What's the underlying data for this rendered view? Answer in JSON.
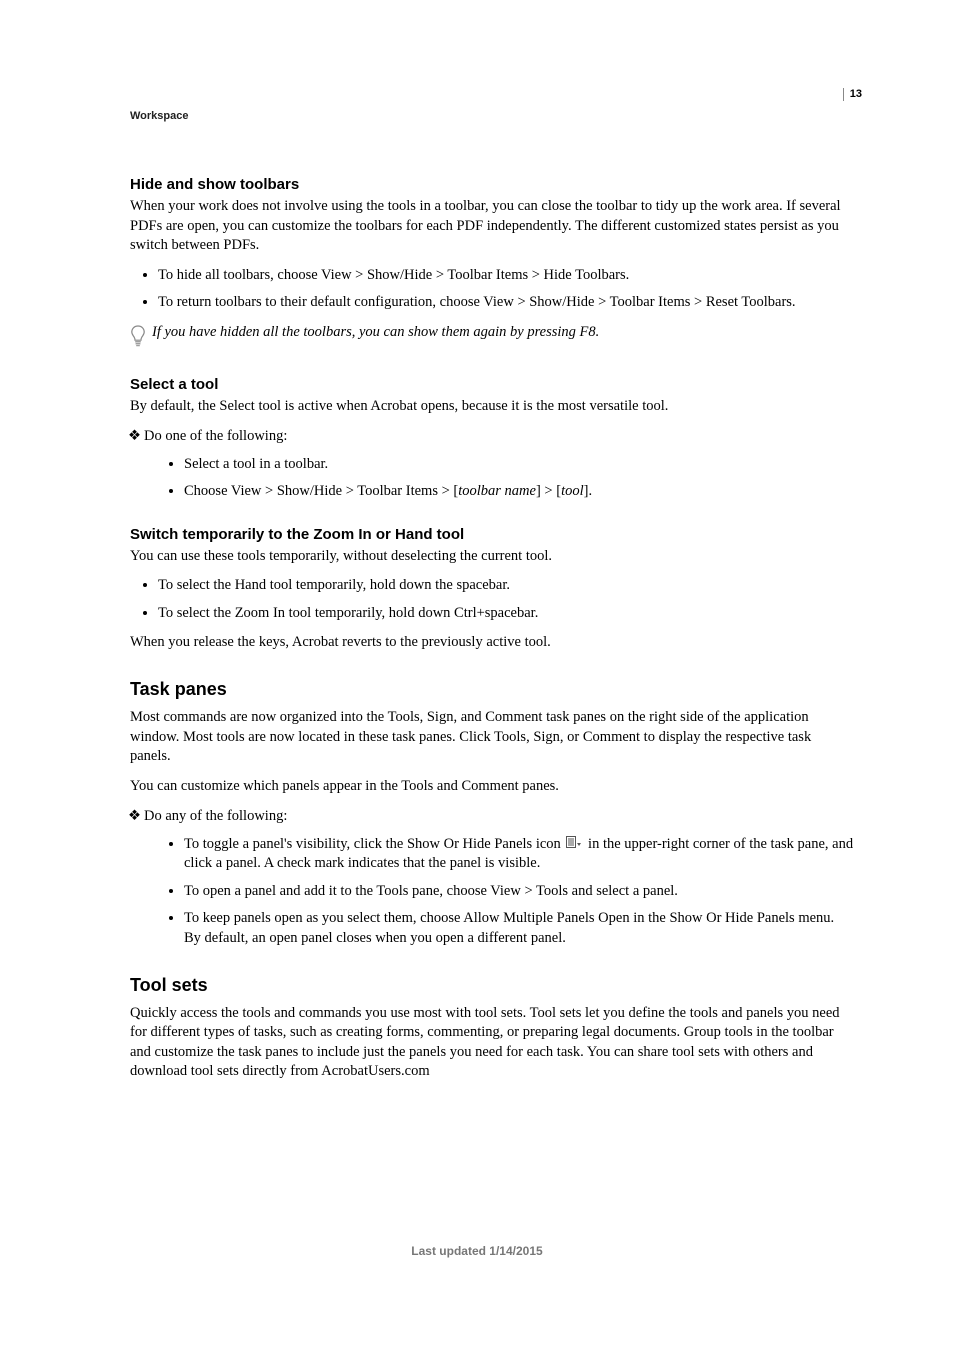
{
  "header": {
    "running_head": "Workspace",
    "page_number": "13"
  },
  "sections": {
    "hide_show": {
      "title": "Hide and show toolbars",
      "p1": "When your work does not involve using the tools in a toolbar, you can close the toolbar to tidy up the work area. If several PDFs are open, you can customize the toolbars for each PDF independently. The different customized states persist as you switch between PDFs.",
      "b1": "To hide all toolbars, choose View > Show/Hide > Toolbar Items > Hide Toolbars.",
      "b2": "To return toolbars to their default configuration, choose View > Show/Hide > Toolbar Items > Reset Toolbars.",
      "tip": "If you have hidden all the toolbars, you can show them again by pressing F8."
    },
    "select_tool": {
      "title": "Select a tool",
      "p1": "By default, the Select tool is active when Acrobat opens, because it is the most versatile tool.",
      "lead": "Do one of the following:",
      "s1": "Select a tool in a toolbar.",
      "s2_pre": "Choose View > Show/Hide > Toolbar Items > [",
      "s2_i1": "toolbar name",
      "s2_mid": "] > [",
      "s2_i2": "tool",
      "s2_post": "]."
    },
    "switch_temp": {
      "title": "Switch temporarily to the Zoom In or Hand tool",
      "p1": "You can use these tools temporarily, without deselecting the current tool.",
      "b1": "To select the Hand tool temporarily, hold down the spacebar.",
      "b2": "To select the Zoom In tool temporarily, hold down Ctrl+spacebar.",
      "p2": "When you release the keys, Acrobat reverts to the previously active tool."
    },
    "task_panes": {
      "title": "Task panes",
      "p1": "Most commands are now organized into the Tools, Sign, and Comment task panes on the right side of the application window. Most tools are now located in these task panes. Click Tools, Sign, or Comment to display the respective task panels.",
      "p2": "You can customize which panels appear in the Tools and Comment panes.",
      "lead": "Do any of the following:",
      "s1_pre": "To toggle a panel's visibility, click the Show Or Hide Panels icon ",
      "s1_post": " in the upper-right corner of the task pane, and click a panel. A check mark indicates that the panel is visible.",
      "s2": "To open a panel and add it to the Tools pane, choose View > Tools and select a panel.",
      "s3": "To keep panels open as you select them, choose Allow Multiple Panels Open in the Show Or Hide Panels menu. By default, an open panel closes when you open a different panel."
    },
    "tool_sets": {
      "title": "Tool sets",
      "p1": "Quickly access the tools and commands you use most with tool sets. Tool sets let you define the tools and panels you need for different types of tasks, such as creating forms, commenting, or preparing legal documents. Group tools in the toolbar and customize the task panes to include just the panels you need for each task. You can share tool sets with others and download tool sets directly from AcrobatUsers.com"
    }
  },
  "footer": {
    "last_updated": "Last updated 1/14/2015"
  }
}
